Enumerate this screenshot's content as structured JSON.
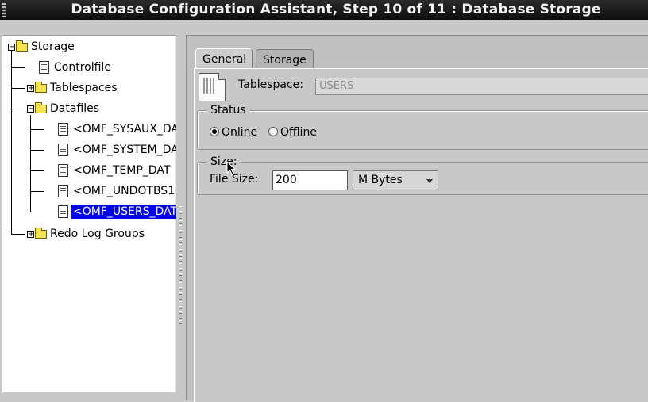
{
  "window": {
    "title": "Database Configuration Assistant, Step 10 of 11 : Database Storage"
  },
  "tree": {
    "root": "Storage",
    "controlfile": "Controlfile",
    "tablespaces": "Tablespaces",
    "datafiles": "Datafiles",
    "datafile_items": [
      "<OMF_SYSAUX_DA",
      "<OMF_SYSTEM_DA",
      "<OMF_TEMP_DAT",
      "<OMF_UNDOTBS1",
      "<OMF_USERS_DAT"
    ],
    "selected_item": "<OMF_USERS_DAT",
    "redo_log_groups": "Redo Log Groups"
  },
  "tabs": {
    "general": "General",
    "storage": "Storage",
    "active": "General"
  },
  "tablespace": {
    "label": "Tablespace:",
    "value": "USERS"
  },
  "status": {
    "legend": "Status",
    "online": "Online",
    "offline": "Offline",
    "selected": "Online"
  },
  "size": {
    "legend": "Size:",
    "file_size_label": "File Size:",
    "file_size_value": "200",
    "unit": "M Bytes"
  },
  "icons": {
    "grip": "window-grip-icon",
    "folder": "folder-icon",
    "file": "datafile-icon",
    "tablespace": "tablespace-icon",
    "cursor": "mouse-pointer-icon"
  },
  "colors": {
    "selection": "#0000e8",
    "background": "#c8c8c8",
    "titlebar": "#111111"
  }
}
